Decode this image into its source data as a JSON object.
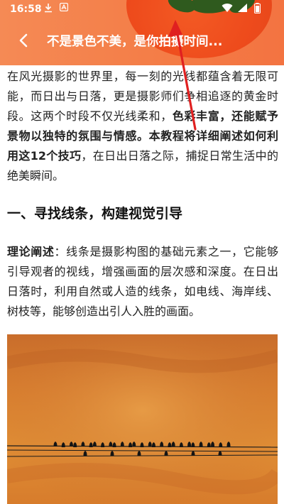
{
  "status": {
    "time": "16:58",
    "download_icon": "download-icon",
    "app_icon": "app-icon",
    "wifi_icon": "wifi-icon",
    "signal_icon": "signal-icon",
    "battery_icon": "battery-icon"
  },
  "header": {
    "back_icon": "chevron-left-icon",
    "title": "不是景色不美，是你拍摄时间...",
    "colors": {
      "bar": "#f47c46",
      "fruit": "#ee4b1c",
      "arrow": "#e02020"
    }
  },
  "article": {
    "intro": {
      "p1": "在风光摄影的世界里，每一刻的光线都蕴含着无限可能，而日出与日落，更是摄影师们争相追逐的黄金时段。这两个时段不仅光线柔和，",
      "p1_bold": "色彩丰富，还能赋予景物以独特的氛围与情感。本教程将详细阐述如何利用这12个技巧",
      "p1_end": "，在日出日落之际，捕捉日常生活中的绝美瞬间。"
    },
    "section1": {
      "heading": "一、寻找线条，构建视觉引导",
      "label": "理论阐述",
      "body": "：线条是摄影构图的基础元素之一，它能够引导观者的视线，增强画面的层次感和深度。在日出日落时，利用自然或人造的线条，如电线、海岸线、树枝等，能够创造出引人入胜的画面。"
    },
    "photo": {
      "subject": "birds-on-power-lines",
      "birds_upper": 27,
      "birds_lower": 6
    }
  }
}
